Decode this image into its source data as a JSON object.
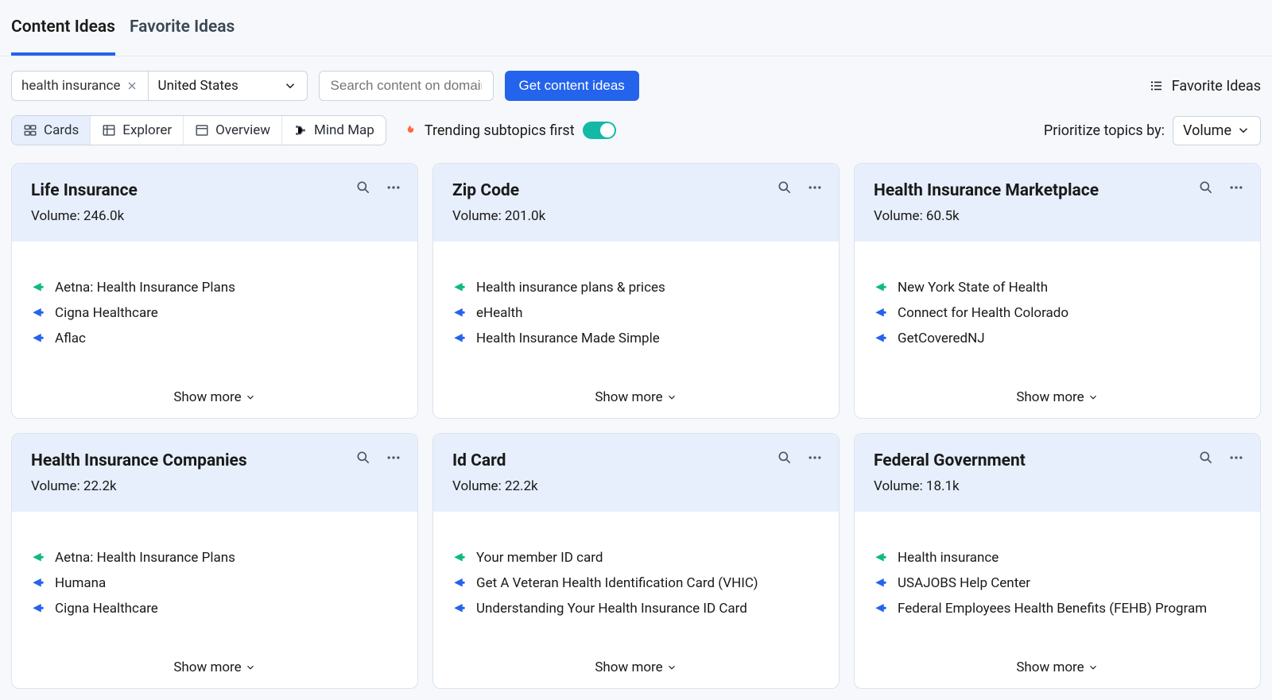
{
  "tabs": {
    "content_ideas": "Content Ideas",
    "favorite_ideas": "Favorite Ideas"
  },
  "filters": {
    "keyword": "health insurance",
    "country": "United States",
    "domain_search_placeholder": "Search content on domain",
    "get_ideas_label": "Get content ideas",
    "favorite_link_label": "Favorite Ideas"
  },
  "views": {
    "cards": "Cards",
    "explorer": "Explorer",
    "overview": "Overview",
    "mindmap": "Mind Map"
  },
  "trending_label": "Trending subtopics first",
  "prioritize_label": "Prioritize topics by:",
  "prioritize_value": "Volume",
  "volume_label": "Volume:",
  "show_more_label": "Show more",
  "cards": [
    {
      "title": "Life Insurance",
      "volume": "246.0k",
      "items": [
        {
          "color": "green",
          "text": "Aetna: Health Insurance Plans"
        },
        {
          "color": "blue",
          "text": "Cigna Healthcare"
        },
        {
          "color": "blue",
          "text": "Aflac"
        }
      ]
    },
    {
      "title": "Zip Code",
      "volume": "201.0k",
      "items": [
        {
          "color": "green",
          "text": "Health insurance plans & prices"
        },
        {
          "color": "blue",
          "text": "eHealth"
        },
        {
          "color": "blue",
          "text": "Health Insurance Made Simple"
        }
      ]
    },
    {
      "title": "Health Insurance Marketplace",
      "volume": "60.5k",
      "items": [
        {
          "color": "green",
          "text": "New York State of Health"
        },
        {
          "color": "blue",
          "text": "Connect for Health Colorado"
        },
        {
          "color": "blue",
          "text": "GetCoveredNJ"
        }
      ]
    },
    {
      "title": "Health Insurance Companies",
      "volume": "22.2k",
      "items": [
        {
          "color": "green",
          "text": "Aetna: Health Insurance Plans"
        },
        {
          "color": "blue",
          "text": "Humana"
        },
        {
          "color": "blue",
          "text": "Cigna Healthcare"
        }
      ]
    },
    {
      "title": "Id Card",
      "volume": "22.2k",
      "items": [
        {
          "color": "green",
          "text": "Your member ID card"
        },
        {
          "color": "blue",
          "text": "Get A Veteran Health Identification Card (VHIC)"
        },
        {
          "color": "blue",
          "text": "Understanding Your Health Insurance ID Card"
        }
      ]
    },
    {
      "title": "Federal Government",
      "volume": "18.1k",
      "items": [
        {
          "color": "green",
          "text": "Health insurance"
        },
        {
          "color": "blue",
          "text": "USAJOBS Help Center"
        },
        {
          "color": "blue",
          "text": "Federal Employees Health Benefits (FEHB) Program"
        }
      ]
    }
  ]
}
